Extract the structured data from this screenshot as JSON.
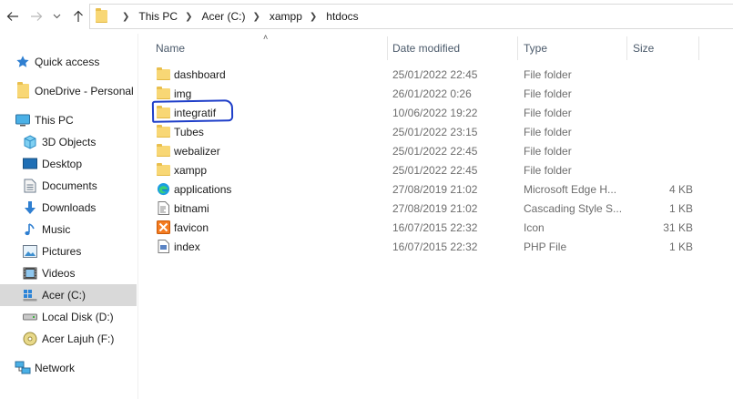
{
  "address": {
    "crumbs": [
      "This PC",
      "Acer (C:)",
      "xampp",
      "htdocs"
    ]
  },
  "sidebar": {
    "items": [
      {
        "label": "Quick access",
        "icon": "star-icon"
      },
      {
        "label": "OneDrive - Personal",
        "icon": "folder-icon"
      },
      {
        "label": "This PC",
        "icon": "computer-icon"
      },
      {
        "label": "3D Objects",
        "icon": "cube-icon"
      },
      {
        "label": "Desktop",
        "icon": "desktop-icon"
      },
      {
        "label": "Documents",
        "icon": "document-icon"
      },
      {
        "label": "Downloads",
        "icon": "download-arrow-icon"
      },
      {
        "label": "Music",
        "icon": "music-note-icon"
      },
      {
        "label": "Pictures",
        "icon": "picture-icon"
      },
      {
        "label": "Videos",
        "icon": "film-icon"
      },
      {
        "label": "Acer (C:)",
        "icon": "windows-drive-icon"
      },
      {
        "label": "Local Disk (D:)",
        "icon": "drive-icon"
      },
      {
        "label": "Acer Lajuh (F:)",
        "icon": "disc-drive-icon"
      },
      {
        "label": "Network",
        "icon": "network-icon"
      }
    ],
    "selected": "Acer (C:)"
  },
  "columns": {
    "name": "Name",
    "date": "Date modified",
    "type": "Type",
    "size": "Size"
  },
  "files": [
    {
      "name": "dashboard",
      "date": "25/01/2022 22:45",
      "type": "File folder",
      "size": "",
      "icon": "folder-icon"
    },
    {
      "name": "img",
      "date": "26/01/2022 0:26",
      "type": "File folder",
      "size": "",
      "icon": "folder-icon"
    },
    {
      "name": "integratif",
      "date": "10/06/2022 19:22",
      "type": "File folder",
      "size": "",
      "icon": "folder-icon"
    },
    {
      "name": "Tubes",
      "date": "25/01/2022 23:15",
      "type": "File folder",
      "size": "",
      "icon": "folder-icon"
    },
    {
      "name": "webalizer",
      "date": "25/01/2022 22:45",
      "type": "File folder",
      "size": "",
      "icon": "folder-icon"
    },
    {
      "name": "xampp",
      "date": "25/01/2022 22:45",
      "type": "File folder",
      "size": "",
      "icon": "folder-icon"
    },
    {
      "name": "applications",
      "date": "27/08/2019 21:02",
      "type": "Microsoft Edge H...",
      "size": "4 KB",
      "icon": "edge-icon"
    },
    {
      "name": "bitnami",
      "date": "27/08/2019 21:02",
      "type": "Cascading Style S...",
      "size": "1 KB",
      "icon": "css-file-icon"
    },
    {
      "name": "favicon",
      "date": "16/07/2015 22:32",
      "type": "Icon",
      "size": "31 KB",
      "icon": "xampp-icon"
    },
    {
      "name": "index",
      "date": "16/07/2015 22:32",
      "type": "PHP File",
      "size": "1 KB",
      "icon": "php-file-icon"
    }
  ],
  "colors": {
    "folder": "#f8d775",
    "selected_bg": "#d9d9d9",
    "annotation": "#1f3fc9",
    "header_text": "#4b5a6b",
    "muted_text": "#6d6d6d"
  }
}
